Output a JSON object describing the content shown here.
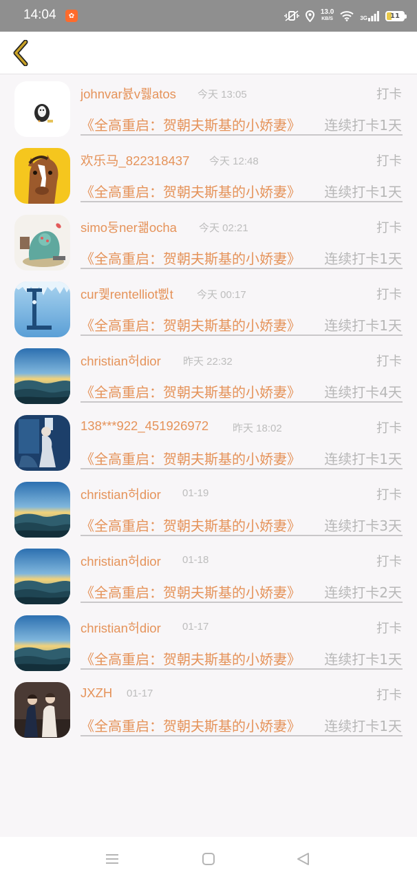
{
  "status_bar": {
    "time": "14:04",
    "speed_value": "13.0",
    "speed_unit": "KB/S",
    "network": "3G",
    "battery": "11",
    "icons": [
      "app-notification-icon",
      "vibrate-icon",
      "location-icon",
      "wifi-icon",
      "signal-icon",
      "battery-icon"
    ]
  },
  "header": {
    "back_icon": "chevron-left-icon"
  },
  "colors": {
    "accent": "#e5935a",
    "muted": "#b7b7b7",
    "time": "#bdbdbd",
    "divider": "#c9c7c9",
    "back_arrow": "#c9a227"
  },
  "checkins": [
    {
      "user": "johnvar뷼v뤯atos",
      "time": "今天 13:05",
      "tag": "打卡",
      "book": "《全高重启：贺朝夫斯基的小娇妻》",
      "streak": "连续打卡1天"
    },
    {
      "user": "欢乐马_822318437",
      "time": "今天 12:48",
      "tag": "打卡",
      "book": "《全高重启：贺朝夫斯基的小娇妻》",
      "streak": "连续打卡1天"
    },
    {
      "user": "simo둥ner괢ocha",
      "time": "今天 02:21",
      "tag": "打卡",
      "book": "《全高重启：贺朝夫斯基的小娇妻》",
      "streak": "连续打卡1天"
    },
    {
      "user": "cur퀯rentelliot삜t",
      "time": "今天 00:17",
      "tag": "打卡",
      "book": "《全高重启：贺朝夫斯基的小娇妻》",
      "streak": "连续打卡1天"
    },
    {
      "user": "christian허dior",
      "time": "昨天 22:32",
      "tag": "打卡",
      "book": "《全高重启：贺朝夫斯基的小娇妻》",
      "streak": "连续打卡4天"
    },
    {
      "user": "138***922_451926972",
      "time": "昨天 18:02",
      "tag": "打卡",
      "book": "《全高重启：贺朝夫斯基的小娇妻》",
      "streak": "连续打卡1天"
    },
    {
      "user": "christian허dior",
      "time": "01-19",
      "tag": "打卡",
      "book": "《全高重启：贺朝夫斯基的小娇妻》",
      "streak": "连续打卡3天"
    },
    {
      "user": "christian허dior",
      "time": "01-18",
      "tag": "打卡",
      "book": "《全高重启：贺朝夫斯基的小娇妻》",
      "streak": "连续打卡2天"
    },
    {
      "user": "christian허dior",
      "time": "01-17",
      "tag": "打卡",
      "book": "《全高重启：贺朝夫斯基的小娇妻》",
      "streak": "连续打卡1天"
    },
    {
      "user": "JXZH",
      "time": "01-17",
      "tag": "打卡",
      "book": "《全高重启：贺朝夫斯基的小娇妻》",
      "streak": "连续打卡1天"
    }
  ],
  "nav_bar": {
    "icons": [
      "menu-icon",
      "home-square-icon",
      "back-triangle-icon"
    ]
  }
}
